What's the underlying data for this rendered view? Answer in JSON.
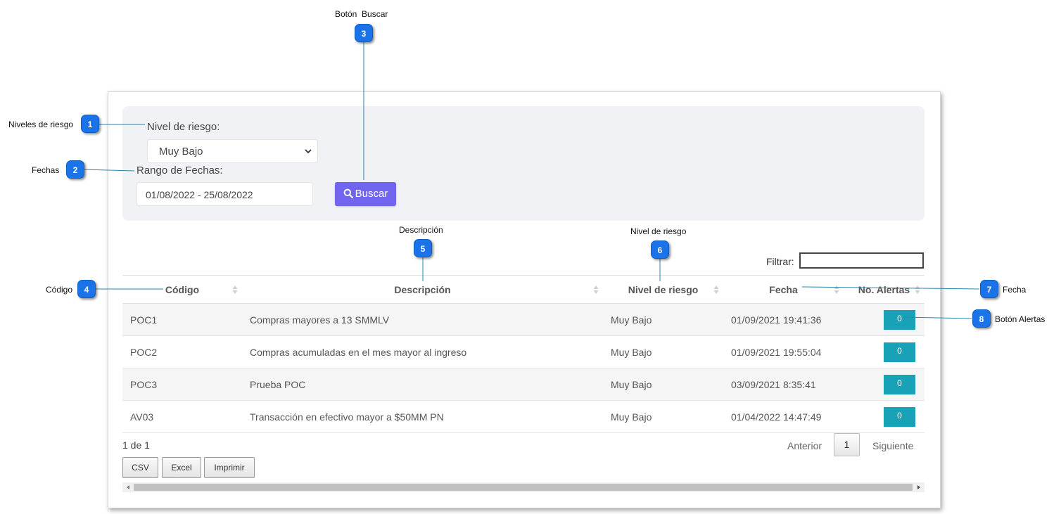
{
  "callouts": [
    {
      "number": "1",
      "label": "Niveles de riesgo"
    },
    {
      "number": "2",
      "label": "Fechas"
    },
    {
      "number": "3",
      "label": "Botón  Buscar"
    },
    {
      "number": "4",
      "label": "Código"
    },
    {
      "number": "5",
      "label": "Descripción"
    },
    {
      "number": "6",
      "label": "Nivel de riesgo"
    },
    {
      "number": "7",
      "label": "Fecha"
    },
    {
      "number": "8",
      "label": "Botón Alertas"
    }
  ],
  "filters": {
    "risk_label": "Nivel de riesgo:",
    "risk_value": "Muy Bajo",
    "date_label": "Rango de Fechas:",
    "date_value": "01/08/2022 - 25/08/2022",
    "search_button": "Buscar"
  },
  "table": {
    "filter_label": "Filtrar:",
    "filter_value": "",
    "headers": [
      "Código",
      "Descripción",
      "Nivel de riesgo",
      "Fecha",
      "No. Alertas"
    ],
    "rows": [
      {
        "code": "POC1",
        "description": "Compras mayores a 13 SMMLV",
        "risk": "Muy Bajo",
        "date": "01/09/2021 19:41:36",
        "alerts": "0"
      },
      {
        "code": "POC2",
        "description": "Compras acumuladas en el mes mayor al ingreso",
        "risk": "Muy Bajo",
        "date": "01/09/2021 19:55:04",
        "alerts": "0"
      },
      {
        "code": "POC3",
        "description": "Prueba POC",
        "risk": "Muy Bajo",
        "date": "03/09/2021 8:35:41",
        "alerts": "0"
      },
      {
        "code": "AV03",
        "description": "Transacción en efectivo mayor a $50MM PN",
        "risk": "Muy Bajo",
        "date": "01/04/2022 14:47:49",
        "alerts": "0"
      }
    ]
  },
  "pagination": {
    "info": "1 de 1",
    "previous": "Anterior",
    "current_page": "1",
    "next": "Siguiente"
  },
  "export": {
    "csv": "CSV",
    "excel": "Excel",
    "print": "Imprimir"
  },
  "colors": {
    "search_button": "#7165ef",
    "alert_button": "#17a2b8",
    "callout_badge": "#1a73e8",
    "leader_line": "#2a86a8",
    "panel_background": "#f1f2f6"
  },
  "icons": {
    "search": "search-icon",
    "dropdown": "chevron-down-icon",
    "sort": "sort-icon"
  }
}
